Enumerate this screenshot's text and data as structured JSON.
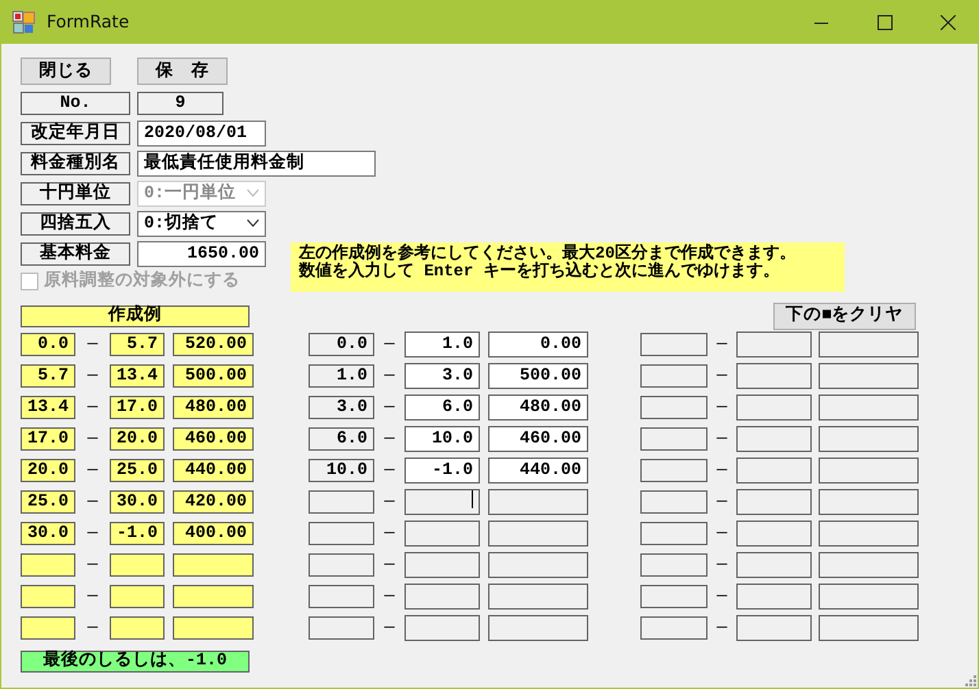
{
  "window": {
    "title": "FormRate"
  },
  "buttons": [
    {
      "label": "閉じる"
    },
    {
      "label": "保　存"
    }
  ],
  "fields": [
    {
      "label": "No.",
      "kind": "display",
      "value": "9"
    },
    {
      "label": "改定年月日",
      "kind": "text",
      "value": "2020/08/01"
    },
    {
      "label": "料金種別名",
      "kind": "text",
      "value": "最低責任使用料金制"
    },
    {
      "label": "十円単位",
      "kind": "combo",
      "value": "0:一円単位",
      "disabled": true
    },
    {
      "label": "四捨五入",
      "kind": "combo",
      "value": "0:切捨て",
      "disabled": false
    },
    {
      "label": "基本料金",
      "kind": "number",
      "value": "1650.00"
    }
  ],
  "checkbox": {
    "label": "原料調整の対象外にする",
    "checked": false,
    "disabled": true
  },
  "note": {
    "lines": [
      "左の作成例を参考にしてください。最大20区分まで作成できます。",
      "数値を入力して Enter キーを打ち込むと次に進んでゆけます。"
    ]
  },
  "example": {
    "title": "作成例",
    "rows": [
      {
        "from": "0.0",
        "dash": "—",
        "to": "5.7",
        "price": "520.00"
      },
      {
        "from": "5.7",
        "dash": "—",
        "to": "13.4",
        "price": "500.00"
      },
      {
        "from": "13.4",
        "dash": "—",
        "to": "17.0",
        "price": "480.00"
      },
      {
        "from": "17.0",
        "dash": "—",
        "to": "20.0",
        "price": "460.00"
      },
      {
        "from": "20.0",
        "dash": "—",
        "to": "25.0",
        "price": "440.00"
      },
      {
        "from": "25.0",
        "dash": "—",
        "to": "30.0",
        "price": "420.00"
      },
      {
        "from": "30.0",
        "dash": "—",
        "to": "-1.0",
        "price": "400.00"
      },
      {
        "dash": "—"
      },
      {
        "dash": "—"
      },
      {
        "dash": "—"
      }
    ]
  },
  "clear_button": {
    "label": "下の■をクリヤ"
  },
  "entry_columns": [
    {
      "rows": [
        {
          "from": "0.0",
          "dash": "—",
          "to": "1.0",
          "price": "0.00",
          "focused": false
        },
        {
          "from": "1.0",
          "dash": "—",
          "to": "3.0",
          "price": "500.00",
          "focused": false
        },
        {
          "from": "3.0",
          "dash": "—",
          "to": "6.0",
          "price": "480.00",
          "focused": false
        },
        {
          "from": "6.0",
          "dash": "—",
          "to": "10.0",
          "price": "460.00",
          "focused": false
        },
        {
          "from": "10.0",
          "dash": "—",
          "to": "-1.0",
          "price": "440.00",
          "focused": false
        },
        {
          "dash": "—",
          "focused": true
        },
        {
          "dash": "—",
          "focused": false
        },
        {
          "dash": "—",
          "focused": false
        },
        {
          "dash": "—",
          "focused": false
        },
        {
          "dash": "—",
          "focused": false
        }
      ]
    },
    {
      "rows": [
        {
          "dash": "—",
          "focused": false
        },
        {
          "dash": "—",
          "focused": false
        },
        {
          "dash": "—",
          "focused": false
        },
        {
          "dash": "—",
          "focused": false
        },
        {
          "dash": "—",
          "focused": false
        },
        {
          "dash": "—",
          "focused": false
        },
        {
          "dash": "—",
          "focused": false
        },
        {
          "dash": "—",
          "focused": false
        },
        {
          "dash": "—",
          "focused": false
        },
        {
          "dash": "—",
          "focused": false
        }
      ]
    }
  ],
  "footer": {
    "text": "最後のしるしは、-1.0"
  }
}
